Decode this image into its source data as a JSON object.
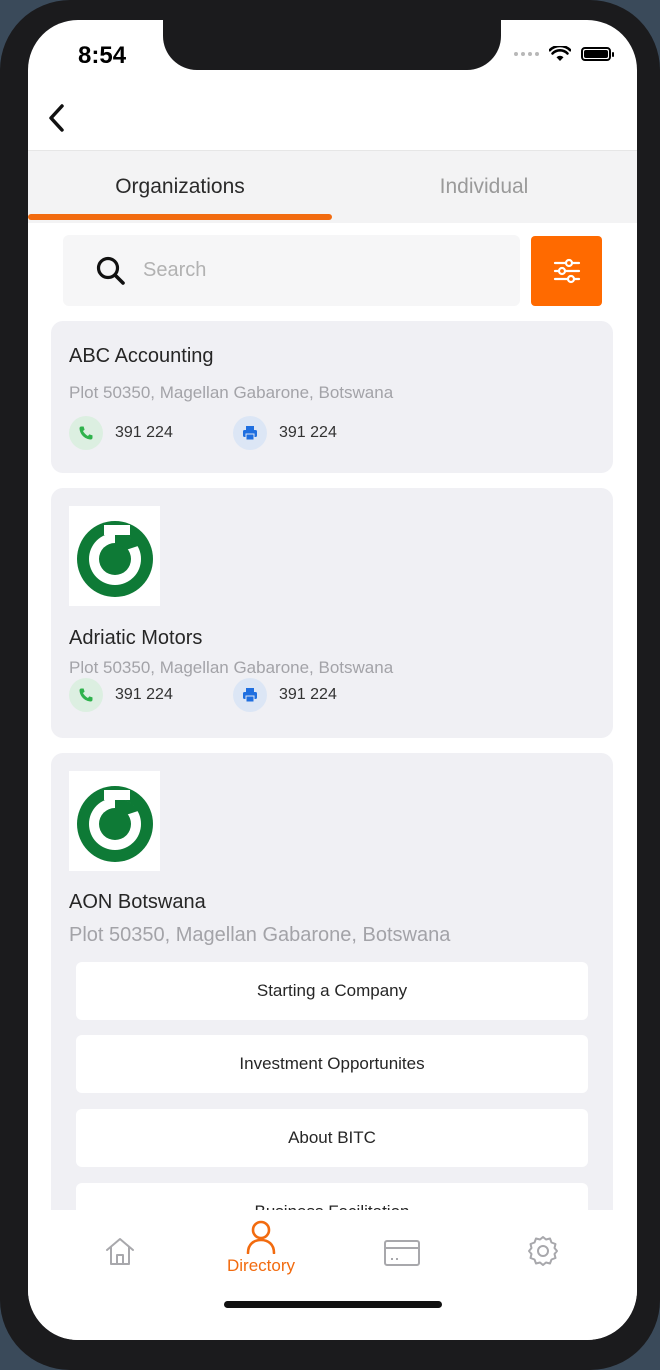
{
  "status_bar": {
    "time": "8:54"
  },
  "tabs": [
    {
      "label": "Organizations",
      "active": true
    },
    {
      "label": "Individual",
      "active": false
    }
  ],
  "search": {
    "placeholder": "Search"
  },
  "organizations": [
    {
      "name": "ABC Accounting",
      "address": "Plot 50350, Magellan Gabarone, Botswana",
      "phone": "391 224",
      "fax": "391 224"
    },
    {
      "name": "Adriatic Motors",
      "address": "Plot 50350, Magellan Gabarone, Botswana",
      "phone": "391 224",
      "fax": "391 224"
    },
    {
      "name": "AON Botswana",
      "address": "Plot 50350, Magellan Gabarone, Botswana"
    }
  ],
  "menu_items": [
    "Starting a Company",
    "Investment Opportunites",
    "About BITC",
    "Business Facilitation"
  ],
  "bottom_nav": [
    {
      "icon": "home-icon",
      "label": ""
    },
    {
      "icon": "person-icon",
      "label": "Directory",
      "active": true
    },
    {
      "icon": "card-icon",
      "label": ""
    },
    {
      "icon": "gear-icon",
      "label": ""
    }
  ],
  "colors": {
    "accent": "#ff6a00",
    "card_bg": "#f0f0f4"
  }
}
